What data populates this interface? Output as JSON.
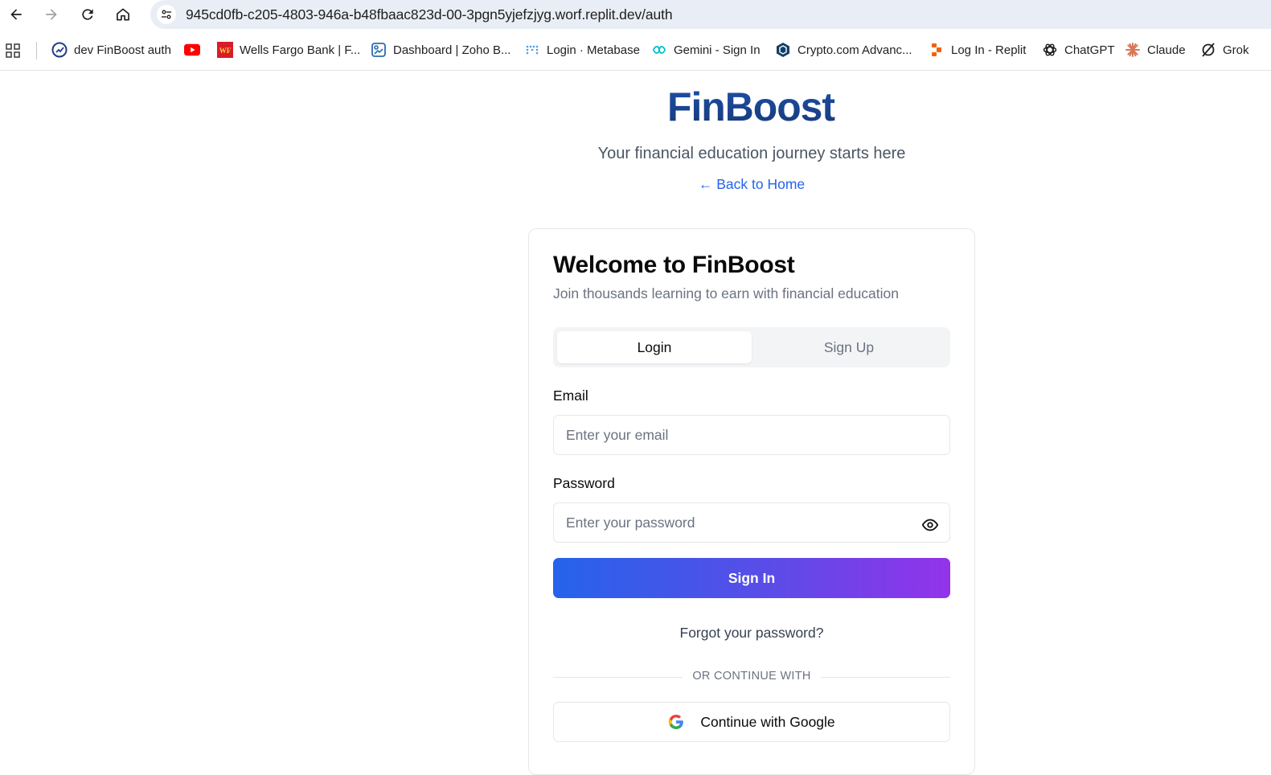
{
  "browser": {
    "url": "945cd0fb-c205-4803-946a-b48fbaac823d-00-3pgn5yjefzjyg.worf.replit.dev/auth"
  },
  "bookmarks": [
    {
      "label": "dev FinBoost auth",
      "icon": "finboost-icon"
    },
    {
      "label": "",
      "icon": "youtube-icon"
    },
    {
      "label": "Wells Fargo Bank | F...",
      "icon": "wells-fargo-icon"
    },
    {
      "label": "Dashboard | Zoho B...",
      "icon": "zoho-books-icon"
    },
    {
      "label": "Login · Metabase",
      "icon": "metabase-icon"
    },
    {
      "label": "Gemini - Sign In",
      "icon": "gemini-icon"
    },
    {
      "label": "Crypto.com Advanc...",
      "icon": "crypto-com-icon"
    },
    {
      "label": "Log In - Replit",
      "icon": "replit-icon"
    },
    {
      "label": "ChatGPT",
      "icon": "chatgpt-icon"
    },
    {
      "label": "Claude",
      "icon": "claude-icon"
    },
    {
      "label": "Grok",
      "icon": "grok-icon"
    }
  ],
  "page": {
    "logo_text": "FinBoost",
    "tagline": "Your financial education journey starts here",
    "back_link": "← Back to Home"
  },
  "card": {
    "title": "Welcome to FinBoost",
    "subtitle": "Join thousands learning to earn with financial education",
    "tabs": [
      {
        "label": "Login",
        "active": true
      },
      {
        "label": "Sign Up",
        "active": false
      }
    ],
    "email_label": "Email",
    "email_placeholder": "Enter your email",
    "password_label": "Password",
    "password_placeholder": "Enter your password",
    "sign_in_label": "Sign In",
    "forgot_label": "Forgot your password?",
    "divider_label": "OR CONTINUE WITH",
    "google_label": "Continue with Google"
  },
  "colors": {
    "accent_blue": "#2563eb",
    "accent_purple": "#9333ea",
    "logo_navy": "#1e3a8a"
  }
}
